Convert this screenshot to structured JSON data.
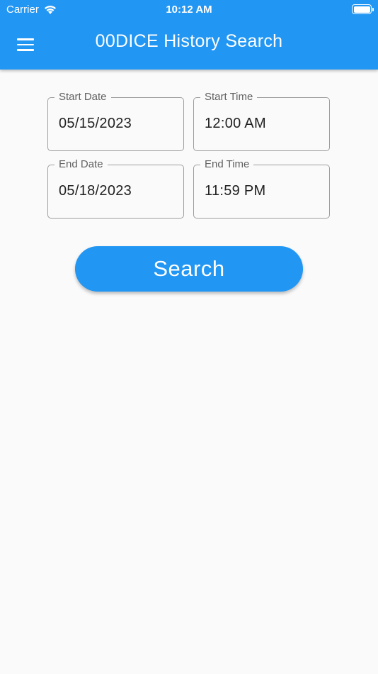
{
  "status_bar": {
    "carrier": "Carrier",
    "time": "10:12 AM"
  },
  "app_bar": {
    "title": "00DICE History Search",
    "color": "#2196f3"
  },
  "form": {
    "start_date": {
      "label": "Start Date",
      "value": "05/15/2023"
    },
    "start_time": {
      "label": "Start Time",
      "value": "12:00 AM"
    },
    "end_date": {
      "label": "End Date",
      "value": "05/18/2023"
    },
    "end_time": {
      "label": "End Time",
      "value": "11:59 PM"
    }
  },
  "search_button": {
    "label": "Search"
  }
}
